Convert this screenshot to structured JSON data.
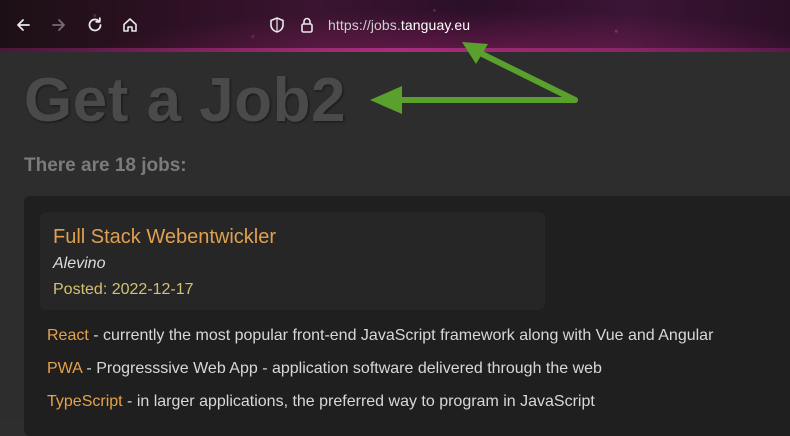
{
  "browser": {
    "url_prefix": "https://jobs.",
    "url_host": "tanguay.eu",
    "icons": {
      "back": "back-arrow-icon",
      "forward": "forward-arrow-icon",
      "reload": "reload-icon",
      "home": "home-icon",
      "shield": "shield-icon",
      "lock": "lock-icon"
    }
  },
  "page": {
    "title": "Get a Job2",
    "job_count": "There are 18 jobs:"
  },
  "jobs": [
    {
      "title": "Full Stack Webentwickler",
      "company": "Alevino",
      "posted": "Posted: 2022-12-17"
    }
  ],
  "skills": [
    {
      "name": "React",
      "description": " - currently the most popular front-end JavaScript framework along with Vue and Angular"
    },
    {
      "name": "PWA",
      "description": " - Progresssive Web App - application software delivered through the web"
    },
    {
      "name": "TypeScript",
      "description": " - in larger applications, the preferred way to program in JavaScript"
    }
  ],
  "colors": {
    "annotation_arrow": "#5aa02c",
    "accent_orange": "#e0a050",
    "posted_yellow": "#d4c074"
  }
}
